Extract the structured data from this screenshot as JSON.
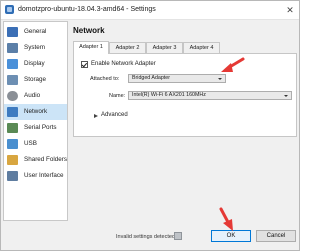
{
  "window": {
    "title": "domotzpro-ubuntu-18.04.3-amd64 - Settings",
    "close_glyph": "✕"
  },
  "sidebar": {
    "items": [
      {
        "label": "General",
        "icon": "general-icon",
        "color": "#3b6fb6"
      },
      {
        "label": "System",
        "icon": "system-icon",
        "color": "#5b7fa8"
      },
      {
        "label": "Display",
        "icon": "display-icon",
        "color": "#4a90d9"
      },
      {
        "label": "Storage",
        "icon": "storage-icon",
        "color": "#6d8fb3"
      },
      {
        "label": "Audio",
        "icon": "audio-icon",
        "color": "#8a8f96"
      },
      {
        "label": "Network",
        "icon": "network-icon",
        "color": "#3e7bc0"
      },
      {
        "label": "Serial Ports",
        "icon": "serial-ports-icon",
        "color": "#5a8a55"
      },
      {
        "label": "USB",
        "icon": "usb-icon",
        "color": "#4a8fcf"
      },
      {
        "label": "Shared Folders",
        "icon": "shared-folders-icon",
        "color": "#d8a640"
      },
      {
        "label": "User Interface",
        "icon": "user-interface-icon",
        "color": "#5f7da0"
      }
    ],
    "active": "Network"
  },
  "main": {
    "title": "Network",
    "tabs": [
      {
        "label": "Adapter 1"
      },
      {
        "label": "Adapter 2"
      },
      {
        "label": "Adapter 3"
      },
      {
        "label": "Adapter 4"
      }
    ],
    "enable_adapter_label": "Enable Network Adapter",
    "attached_to_label": "Attached to:",
    "attached_to_value": "Bridged Adapter",
    "name_label": "Name:",
    "name_value": "Intel(R) Wi-Fi 6 AX201 160MHz",
    "advanced_label": "Advanced"
  },
  "footer": {
    "status": "Invalid settings detected",
    "ok_label": "OK",
    "cancel_label": "Cancel"
  },
  "colors": {
    "annotation_arrow": "#e53935",
    "selection": "#cce4f7",
    "primary_border": "#0078d7"
  }
}
